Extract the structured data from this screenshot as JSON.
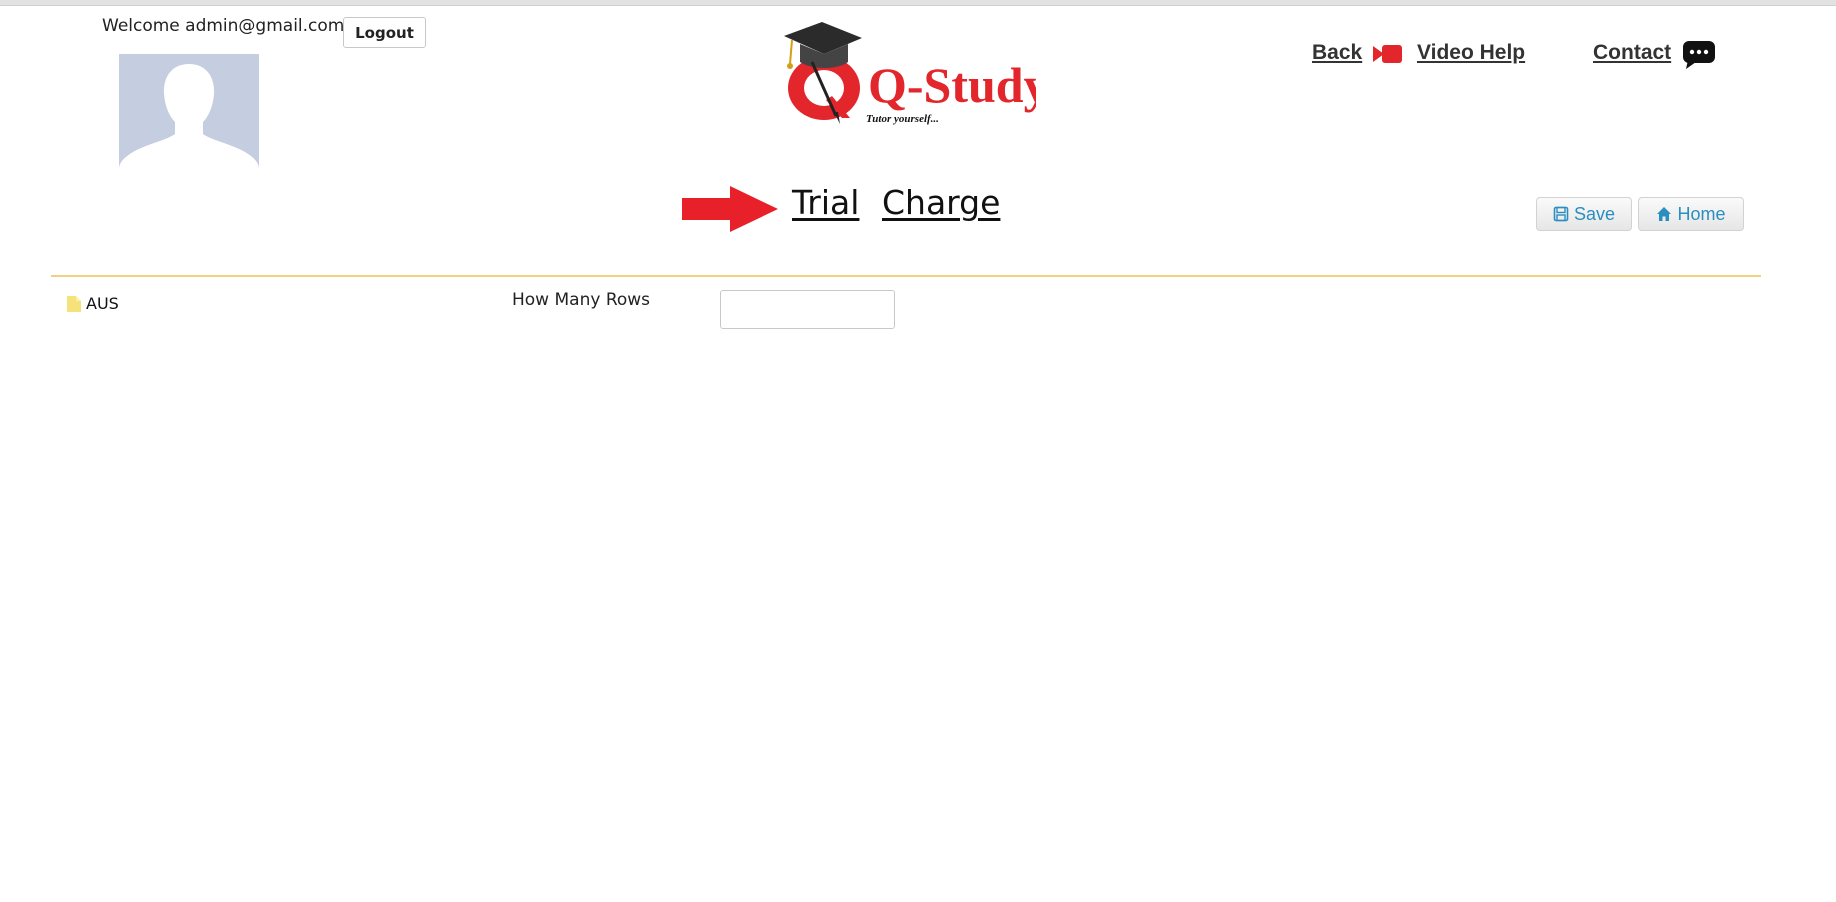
{
  "header": {
    "welcome_text": "Welcome admin@gmail.com",
    "logout_label": "Logout",
    "avatar": "default-user-silhouette",
    "logo": {
      "brand_text": "Q-Study",
      "tagline": "Tutor yourself...",
      "icon": "graduation-cap-icon",
      "colors": {
        "brand": "#e2262b",
        "cap": "#333333"
      }
    },
    "nav": {
      "back_label": "Back",
      "video_help_label": "Video Help",
      "contact_label": "Contact",
      "video_icon_color": "#e2262b"
    }
  },
  "tabs": {
    "pointer_icon": "red-arrow-right-icon",
    "pointer_color": "#e8202a",
    "trial_label": "Trial",
    "charge_label": "Charge"
  },
  "toolbar": {
    "save_label": "Save",
    "home_label": "Home",
    "accent_color": "#2a8ec0"
  },
  "divider_color": "#f3cf7f",
  "tree": {
    "items": [
      {
        "label": "AUS",
        "icon": "file-icon"
      }
    ]
  },
  "form": {
    "rows_label": "How Many Rows",
    "rows_value": "",
    "rows_placeholder": ""
  }
}
